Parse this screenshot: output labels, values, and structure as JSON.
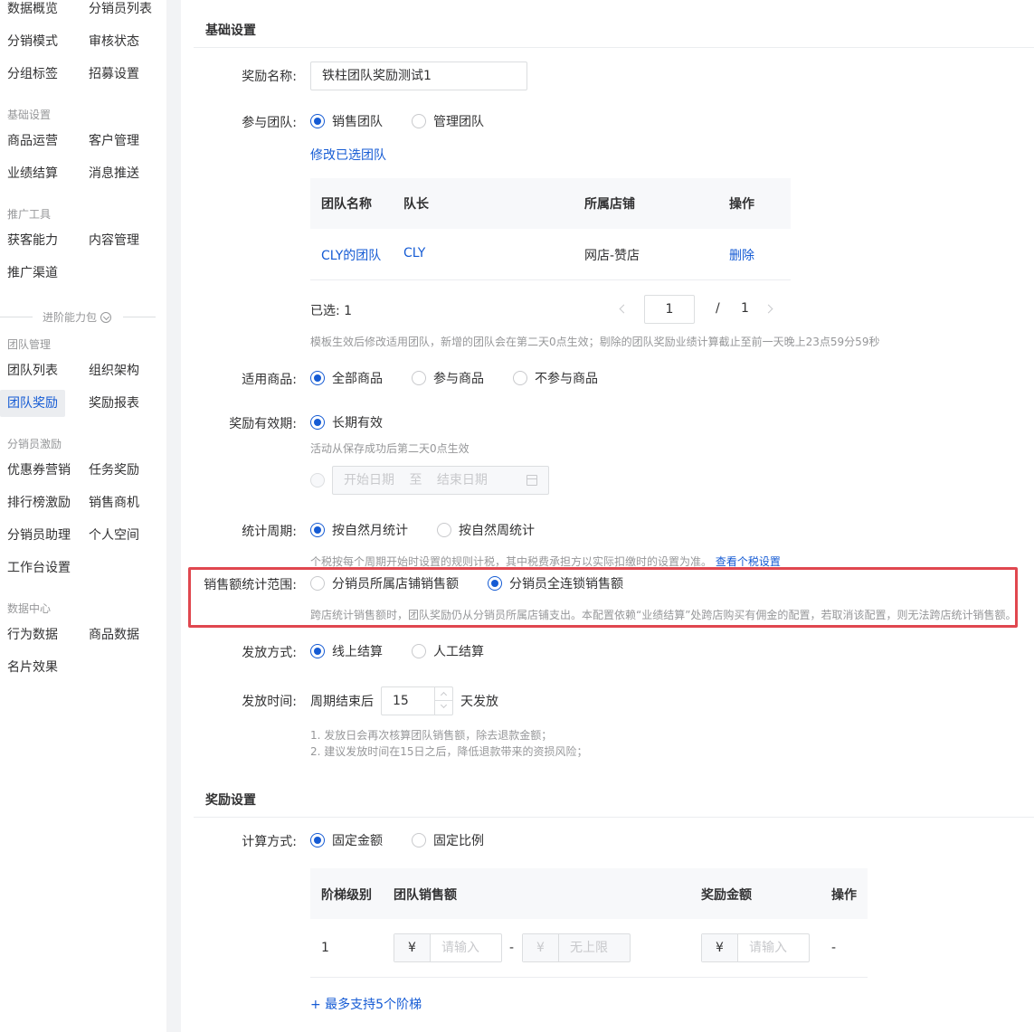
{
  "sidebar": {
    "top_items": [
      {
        "label": "数据概览"
      },
      {
        "label": "分销员列表"
      },
      {
        "label": "分销模式"
      },
      {
        "label": "审核状态"
      },
      {
        "label": "分组标签"
      },
      {
        "label": "招募设置"
      }
    ],
    "sections": [
      {
        "title": "基础设置",
        "items": [
          {
            "label": "商品运营"
          },
          {
            "label": "客户管理"
          },
          {
            "label": "业绩结算"
          },
          {
            "label": "消息推送"
          }
        ]
      },
      {
        "title": "推广工具",
        "items": [
          {
            "label": "获客能力"
          },
          {
            "label": "内容管理"
          },
          {
            "label": "推广渠道"
          }
        ]
      }
    ],
    "advanced_label": "进阶能力包",
    "sections2": [
      {
        "title": "团队管理",
        "items": [
          {
            "label": "团队列表"
          },
          {
            "label": "组织架构"
          },
          {
            "label": "团队奖励"
          },
          {
            "label": "奖励报表"
          }
        ]
      },
      {
        "title": "分销员激励",
        "items": [
          {
            "label": "优惠券营销"
          },
          {
            "label": "任务奖励"
          },
          {
            "label": "排行榜激励"
          },
          {
            "label": "销售商机"
          },
          {
            "label": "分销员助理"
          },
          {
            "label": "个人空间"
          },
          {
            "label": "工作台设置"
          }
        ]
      },
      {
        "title": "数据中心",
        "items": [
          {
            "label": "行为数据"
          },
          {
            "label": "商品数据"
          },
          {
            "label": "名片效果"
          }
        ]
      }
    ]
  },
  "basic": {
    "title": "基础设置",
    "name_label": "奖励名称:",
    "name_value": "铁柱团队奖励测试1",
    "team_label": "参与团队:",
    "team_options": [
      "销售团队",
      "管理团队"
    ],
    "modify_team_link": "修改已选团队",
    "team_table": {
      "headers": [
        "团队名称",
        "队长",
        "所属店铺",
        "操作"
      ],
      "rows": [
        [
          "CLY的团队",
          "CLY",
          "网店-赞店",
          "删除"
        ]
      ]
    },
    "selected_text": "已选: 1",
    "pager": {
      "current": "1",
      "sep": "/",
      "total": "1"
    },
    "team_hint": "模板生效后修改适用团队，新增的团队会在第二天0点生效；剔除的团队奖励业绩计算截止至前一天晚上23点59分59秒",
    "goods_label": "适用商品:",
    "goods_options": [
      "全部商品",
      "参与商品",
      "不参与商品"
    ],
    "valid_label": "奖励有效期:",
    "valid_option": "长期有效",
    "valid_hint": "活动从保存成功后第二天0点生效",
    "date_start": "开始日期",
    "date_to": "至",
    "date_end": "结束日期",
    "period_label": "统计周期:",
    "period_options": [
      "按自然月统计",
      "按自然周统计"
    ],
    "period_hint": "个税按每个周期开始时设置的规则计税，其中税费承担方以实际扣缴时的设置为准。",
    "period_link": "查看个税设置",
    "scope_label": "销售额统计范围:",
    "scope_options": [
      "分销员所属店铺销售额",
      "分销员全连锁销售额"
    ],
    "scope_hint": "跨店统计销售额时，团队奖励仍从分销员所属店铺支出。本配置依赖“业绩结算”处跨店购买有佣金的配置，若取消该配置，则无法跨店统计销售额。",
    "pay_label": "发放方式:",
    "pay_options": [
      "线上结算",
      "人工结算"
    ],
    "paytime_label": "发放时间:",
    "paytime_prefix": "周期结束后",
    "paytime_value": "15",
    "paytime_suffix": "天发放",
    "paytime_hint1": "1. 发放日会再次核算团队销售额，除去退款金额；",
    "paytime_hint2": "2. 建议发放时间在15日之后，降低退款带来的资损风险；"
  },
  "reward": {
    "title": "奖励设置",
    "calc_label": "计算方式:",
    "calc_options": [
      "固定金额",
      "固定比例"
    ],
    "table_headers": [
      "阶梯级别",
      "团队销售额",
      "奖励金额",
      "操作"
    ],
    "row_level": "1",
    "currency": "¥",
    "placeholder": "请输入",
    "no_limit": "无上限",
    "dash": "-",
    "op_dash": "-",
    "add_tier": "+ 最多支持5个阶梯"
  },
  "colors": {
    "accent": "#155bd4",
    "highlight_border": "#e0474f"
  }
}
